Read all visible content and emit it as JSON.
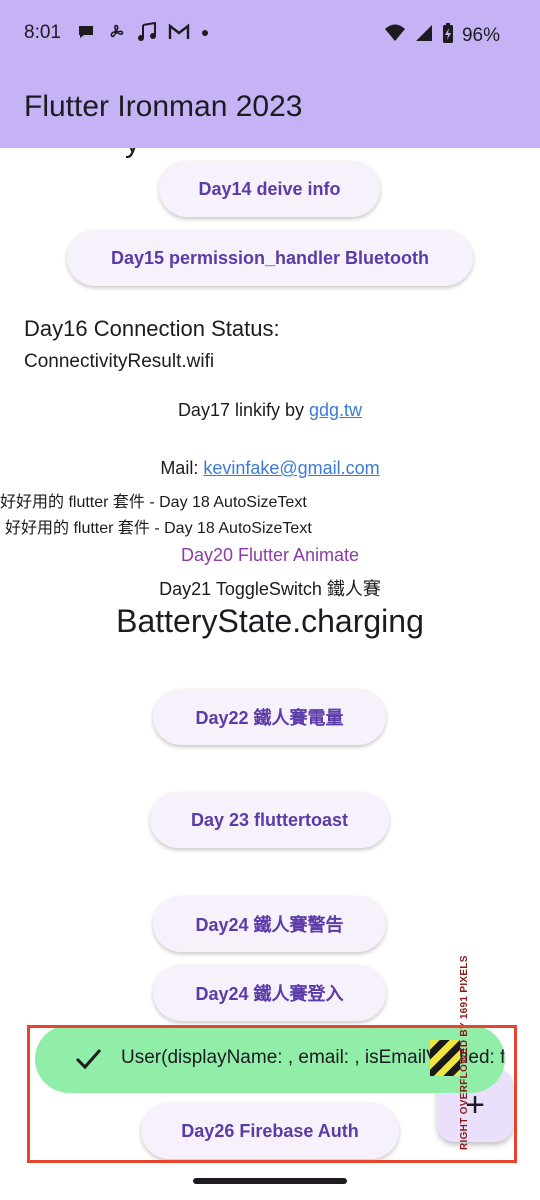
{
  "status_bar": {
    "time": "8:01",
    "battery": "96%",
    "left_icons": [
      "chat-bubble-icon",
      "fan-icon",
      "music-note-icon",
      "gmail-icon",
      "dot-icon"
    ],
    "right_icons": [
      "wifi-icon",
      "signal-icon",
      "battery-charging-icon"
    ]
  },
  "app_bar": {
    "title": "Flutter Ironman 2023"
  },
  "content": {
    "partial_text": "y",
    "day14_button": "Day14 deive info",
    "day15_button": "Day15 permission_handler Bluetooth",
    "day16_label": "Day16 Connection Status:",
    "day16_value": "ConnectivityResult.wifi",
    "day17_prefix": "Day17 linkify by ",
    "day17_link": "gdg.tw",
    "mail_prefix": "Mail: ",
    "mail_link": "kevinfake@gmail.com",
    "autosize_1": "好好用的 flutter 套件 - Day 18 AutoSizeText",
    "autosize_2": "好好用的 flutter 套件 - Day 18 AutoSizeText",
    "day20_text": "Day20 Flutter Animate",
    "day21_text": "Day21 ToggleSwitch 鐵人賽",
    "battery_state": "BatteryState.charging",
    "day22_button": "Day22 鐵人賽電量",
    "day23_button": "Day 23 fluttertoast",
    "day24_alert_button": "Day24 鐵人賽警告",
    "day24_login_button": "Day24 鐵人賽登入",
    "day26_button": "Day26 Firebase Auth"
  },
  "snackbar": {
    "text": "User(displayName: , email: , isEmailVerified: false"
  },
  "fab": {
    "icon": "add-icon",
    "symbol": "+"
  },
  "overflow": {
    "label": "RIGHT OVERFLOWED BY 1691 PIXELS"
  },
  "colors": {
    "app_bar": "#c5b3f5",
    "button_text": "#5b3ba8",
    "button_bg": "#f6f1fb",
    "link": "#3b7bd8",
    "animate_text": "#8e3aa9",
    "snackbar_bg": "#90eea8",
    "highlight_border": "#e5452e"
  }
}
